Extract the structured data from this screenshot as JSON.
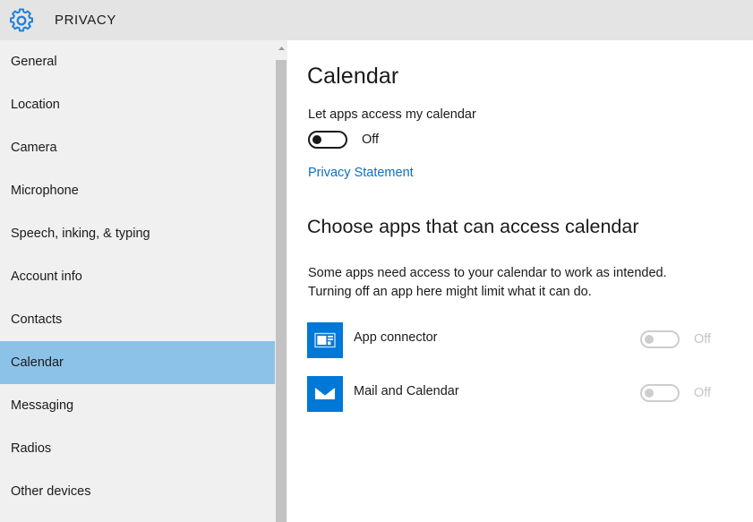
{
  "window": {
    "title": "PRIVACY",
    "gear_icon": "gear-icon"
  },
  "sidebar": {
    "items": [
      {
        "label": "General",
        "selected": false
      },
      {
        "label": "Location",
        "selected": false
      },
      {
        "label": "Camera",
        "selected": false
      },
      {
        "label": "Microphone",
        "selected": false
      },
      {
        "label": "Speech, inking, & typing",
        "selected": false
      },
      {
        "label": "Account info",
        "selected": false
      },
      {
        "label": "Contacts",
        "selected": false
      },
      {
        "label": "Calendar",
        "selected": true
      },
      {
        "label": "Messaging",
        "selected": false
      },
      {
        "label": "Radios",
        "selected": false
      },
      {
        "label": "Other devices",
        "selected": false
      }
    ],
    "scrollbar": {
      "up_arrow_icon": "chevron-up-icon"
    }
  },
  "main": {
    "page_title": "Calendar",
    "master_toggle": {
      "label": "Let apps access my calendar",
      "state_text": "Off",
      "enabled": true,
      "on": false
    },
    "privacy_link": "Privacy Statement",
    "section": {
      "title": "Choose apps that can access calendar",
      "description": "Some apps need access to your calendar to work as intended. Turning off an app here might limit what it can do."
    },
    "apps": [
      {
        "name": "App connector",
        "icon": "app-connector-icon",
        "icon_color": "#0078d7",
        "state_text": "Off",
        "on": false,
        "enabled": false
      },
      {
        "name": "Mail and Calendar",
        "icon": "mail-icon",
        "icon_color": "#0078d7",
        "state_text": "Off",
        "on": false,
        "enabled": false
      }
    ]
  },
  "colors": {
    "header_bg": "#e4e4e4",
    "sidebar_bg": "#f0f0f0",
    "selection": "#8cc2e8",
    "accent": "#0078d7",
    "link": "#0a70c4",
    "scroll_thumb": "#c2c2c2"
  }
}
